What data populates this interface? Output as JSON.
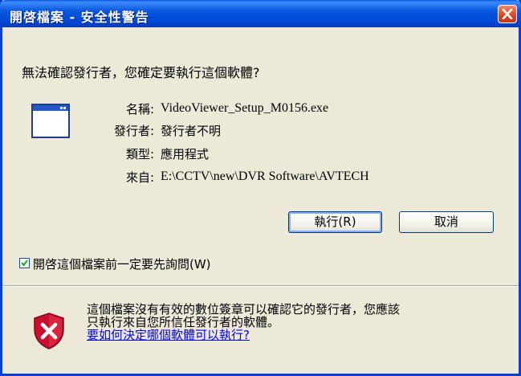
{
  "window": {
    "title": "開啓檔案 - 安全性警告"
  },
  "question": "無法確認發行者，您確定要執行這個軟體?",
  "details": {
    "name_label": "名稱:",
    "name_value": "VideoViewer_Setup_M0156.exe",
    "publisher_label": "發行者:",
    "publisher_value": "發行者不明",
    "type_label": "類型:",
    "type_value": "應用程式",
    "from_label": "來自:",
    "from_value": "E:\\CCTV\\new\\DVR Software\\AVTECH"
  },
  "buttons": {
    "run": "執行(R)",
    "cancel": "取消"
  },
  "checkbox": {
    "label": "開啓這個檔案前一定要先詢問(W)",
    "checked": true
  },
  "warning": {
    "line1": "這個檔案沒有有效的數位簽章可以確認它的發行者，您應該",
    "line2": "只執行來自您所信任發行者的軟體。",
    "link": "要如何決定哪個軟體可以執行?"
  },
  "icons": {
    "app": "application-window-icon",
    "close": "close-icon",
    "shield": "security-shield-icon"
  },
  "colors": {
    "title_bar": "#0a57e0",
    "close_button": "#d9441f",
    "dialog_bg": "#ece9d8",
    "link": "#0000ff"
  }
}
